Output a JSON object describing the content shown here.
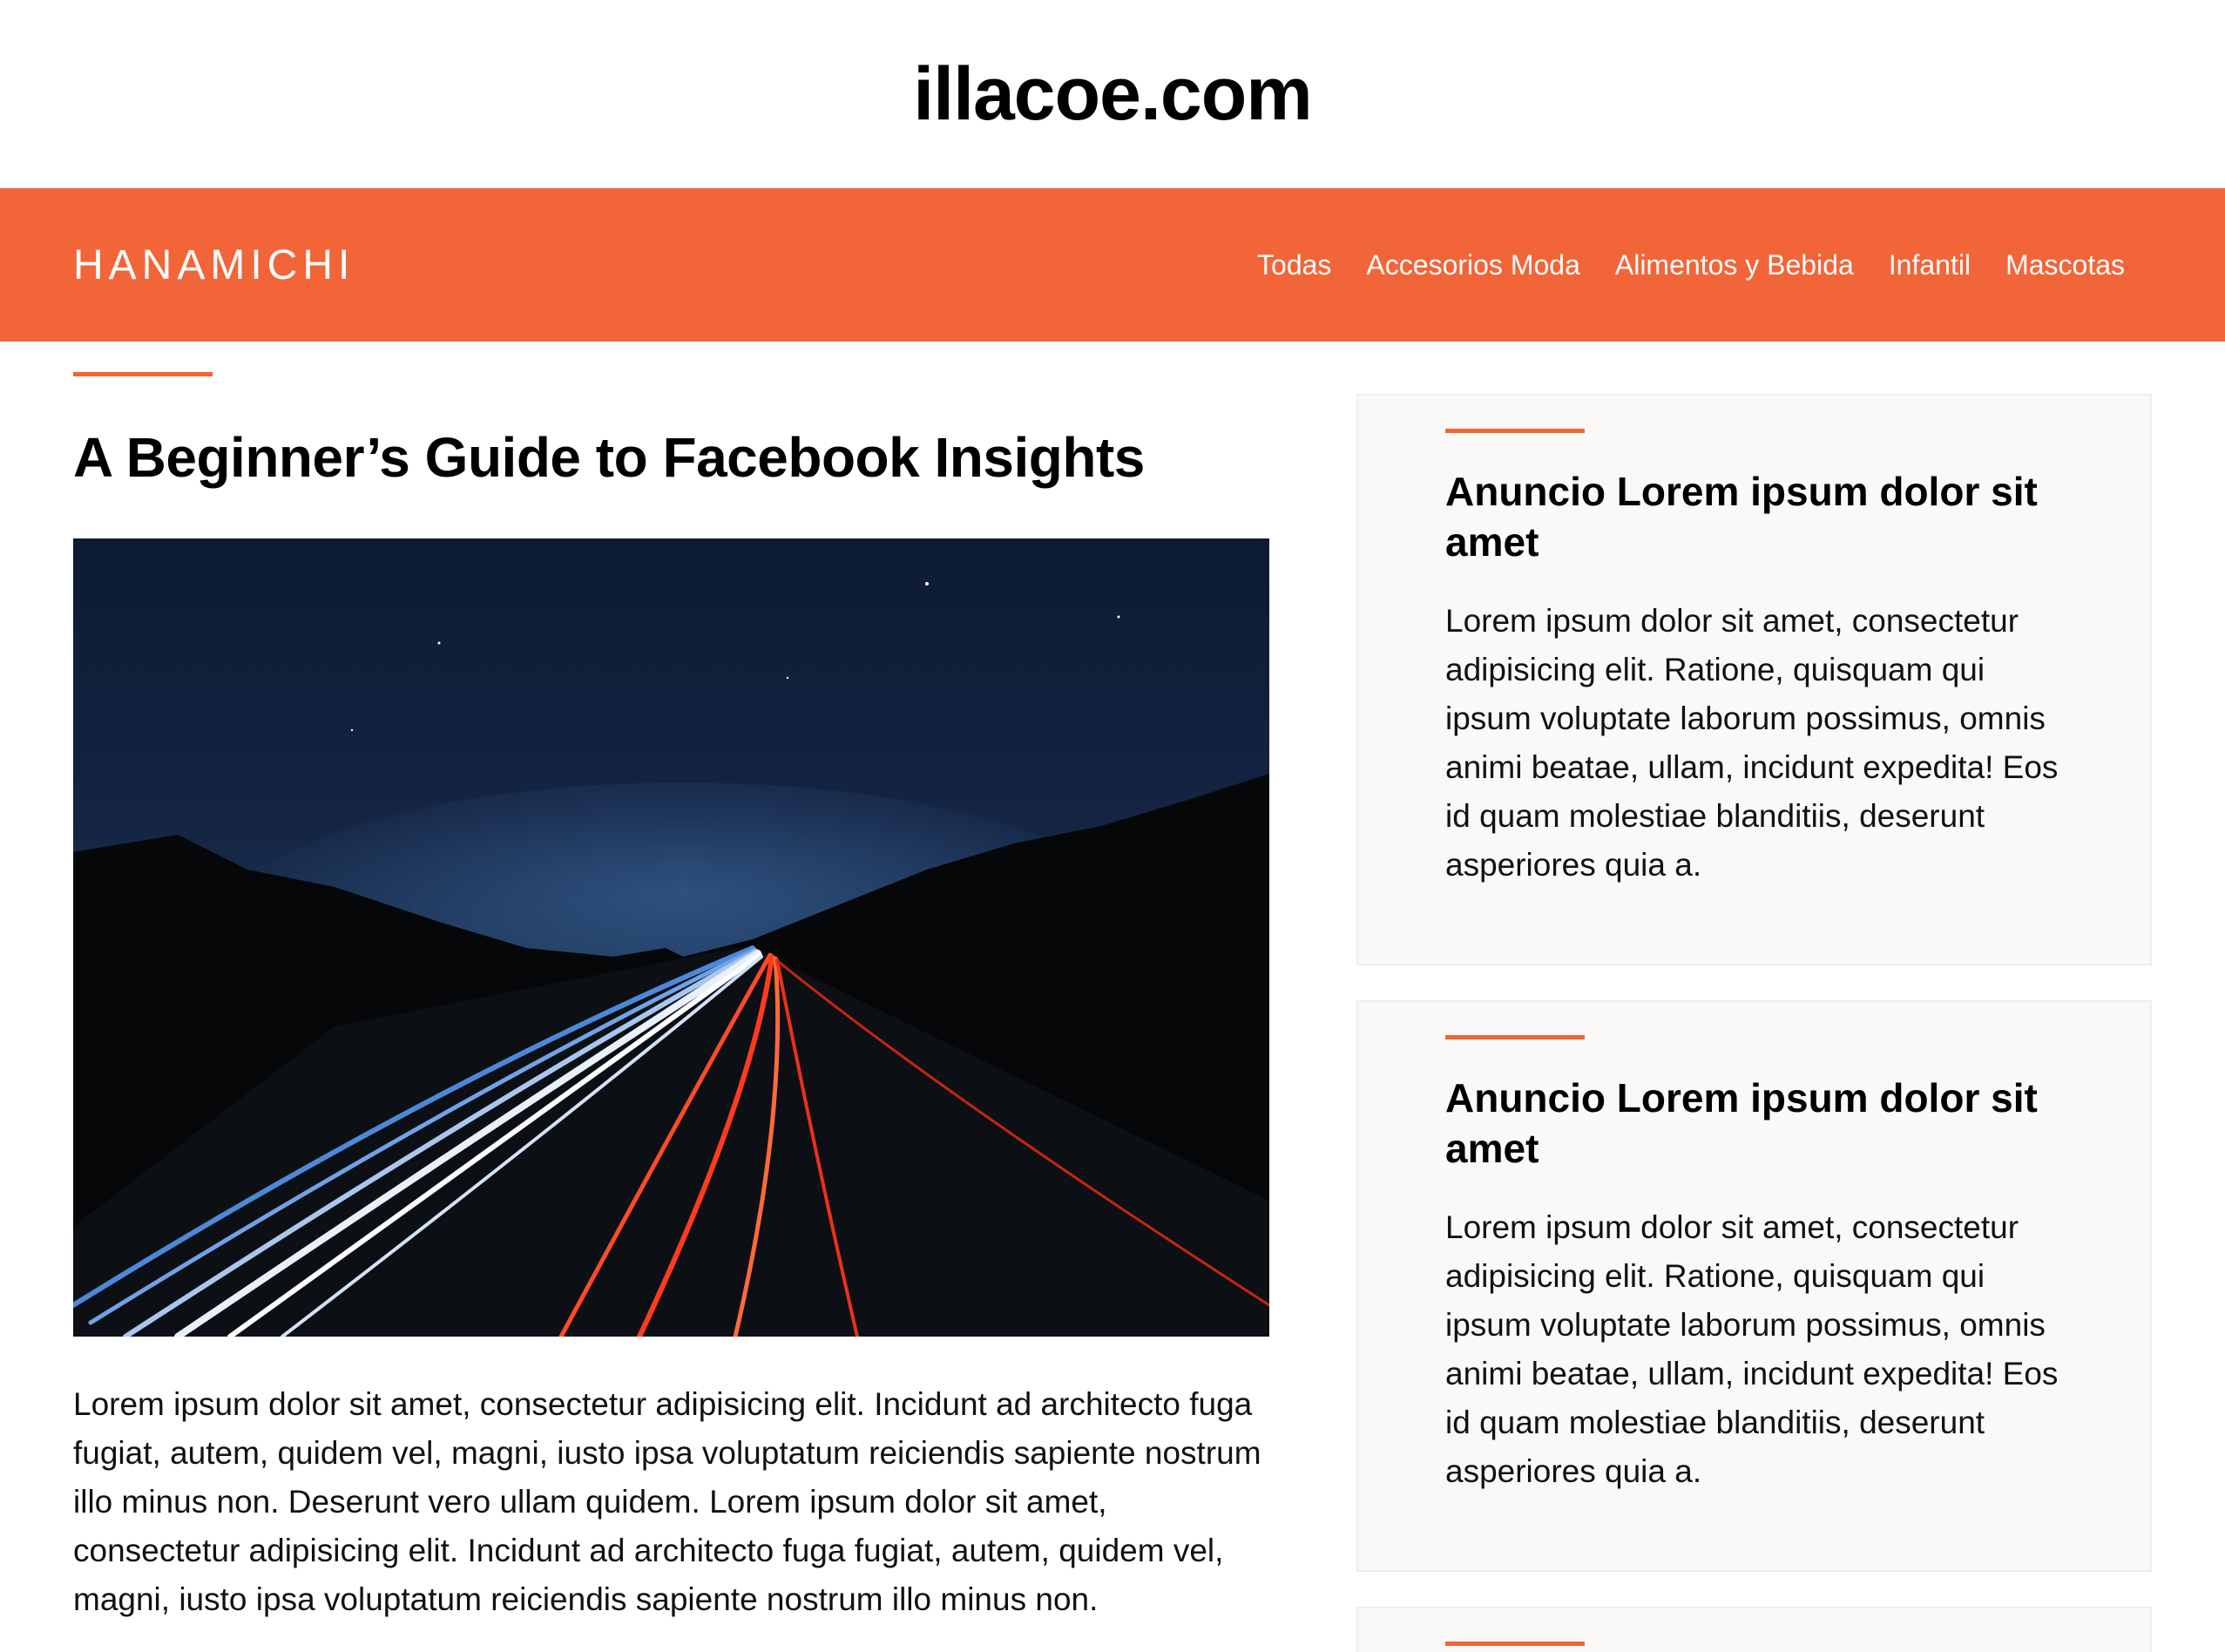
{
  "site": {
    "domain": "illacoe.com"
  },
  "nav": {
    "brand": "HANAMICHI",
    "links": [
      "Todas",
      "Accesorios Moda",
      "Alimentos y Bebida",
      "Infantil",
      "Mascotas"
    ]
  },
  "post": {
    "title": "A Beginner’s Guide to Facebook Insights",
    "body": "Lorem ipsum dolor sit amet, consectetur adipisicing elit. Incidunt ad architecto fuga fugiat, autem, quidem vel, magni, iusto ipsa voluptatum reiciendis sapiente nostrum illo minus non. Deserunt vero ullam quidem. Lorem ipsum dolor sit amet, consectetur adipisicing elit. Incidunt ad architecto fuga fugiat, autem, quidem vel, magni, iusto ipsa voluptatum reiciendis sapiente nostrum illo minus non."
  },
  "sidebar": {
    "cards": [
      {
        "title": "Anuncio Lorem ipsum dolor sit amet",
        "text": "Lorem ipsum dolor sit amet, consectetur adipisicing elit. Ratione, quisquam qui ipsum voluptate laborum possimus, omnis animi beatae, ullam, incidunt expedita! Eos id quam molestiae blanditiis, deserunt asperiores quia a."
      },
      {
        "title": "Anuncio Lorem ipsum dolor sit amet",
        "text": "Lorem ipsum dolor sit amet, consectetur adipisicing elit. Ratione, quisquam qui ipsum voluptate laborum possimus, omnis animi beatae, ullam, incidunt expedita! Eos id quam molestiae blanditiis, deserunt asperiores quia a."
      }
    ]
  },
  "colors": {
    "accent": "#f26539",
    "card_bg": "#faf9f7"
  }
}
